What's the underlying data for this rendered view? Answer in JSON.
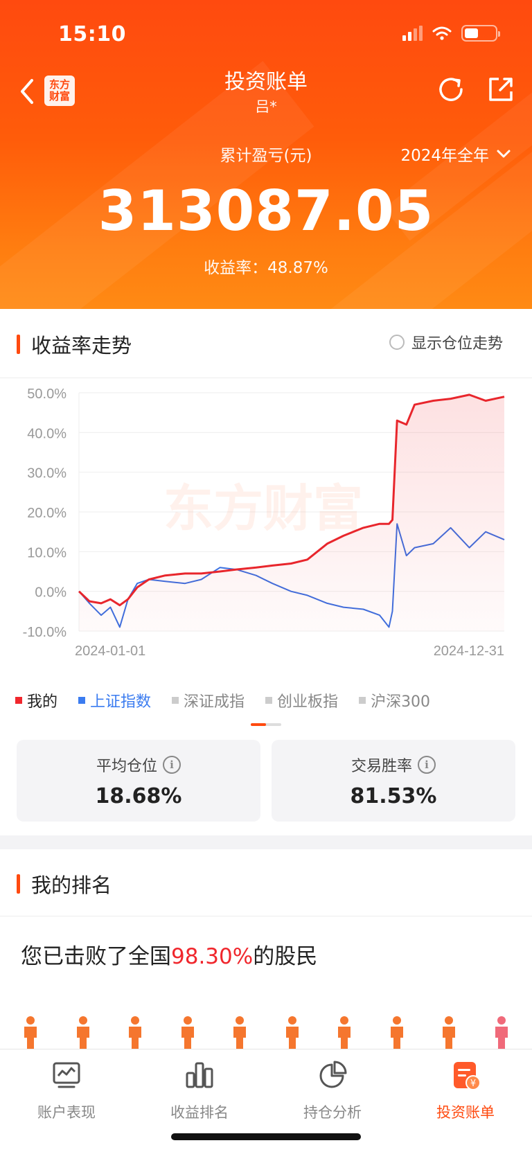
{
  "status": {
    "time": "15:10"
  },
  "header": {
    "logo_text": "东方\n财富",
    "title": "投资账单",
    "subtitle": "吕*",
    "pl_label": "累计盈亏(元)",
    "period": "2024年全年",
    "total_pl": "313087.05",
    "rate_line": "收益率：48.87%"
  },
  "trend": {
    "title": "收益率走势",
    "toggle_label": "显示仓位走势",
    "legend": [
      {
        "label": "我的",
        "color": "#f0272d",
        "text_color": "#222222"
      },
      {
        "label": "上证指数",
        "color": "#3b7cf0",
        "text_color": "#3b7cf0"
      },
      {
        "label": "深证成指",
        "color": "#cccccc",
        "text_color": "#888888"
      },
      {
        "label": "创业板指",
        "color": "#cccccc",
        "text_color": "#888888"
      },
      {
        "label": "沪深300",
        "color": "#cccccc",
        "text_color": "#888888"
      }
    ],
    "watermark": "东方财富"
  },
  "chart_data": {
    "type": "line",
    "x_start": "2024-01-01",
    "x_end": "2024-12-31",
    "yticks": [
      "50.0%",
      "40.0%",
      "30.0%",
      "20.0%",
      "10.0%",
      "0.0%",
      "-10.0%"
    ],
    "ylim": [
      -10,
      50
    ],
    "grid": true,
    "series": [
      {
        "name": "我的",
        "color": "#e8262c",
        "x": [
          "2024-01-01",
          "2024-01-10",
          "2024-01-20",
          "2024-01-28",
          "2024-02-05",
          "2024-02-12",
          "2024-02-20",
          "2024-03-01",
          "2024-03-15",
          "2024-04-01",
          "2024-04-15",
          "2024-05-01",
          "2024-05-15",
          "2024-06-01",
          "2024-06-15",
          "2024-07-01",
          "2024-07-15",
          "2024-08-01",
          "2024-08-15",
          "2024-09-01",
          "2024-09-15",
          "2024-09-23",
          "2024-09-26",
          "2024-09-30",
          "2024-10-08",
          "2024-10-15",
          "2024-10-31",
          "2024-11-15",
          "2024-12-01",
          "2024-12-15",
          "2024-12-31"
        ],
        "values": [
          0,
          -2.5,
          -3,
          -2,
          -3.5,
          -2,
          1,
          3,
          4,
          4.5,
          4.5,
          5,
          5.5,
          6,
          6.5,
          7,
          8,
          12,
          14,
          16,
          17,
          17,
          18,
          43,
          42,
          47,
          48,
          48.5,
          49.5,
          48,
          49
        ]
      },
      {
        "name": "上证指数",
        "color": "#3b6fe0",
        "x": [
          "2024-01-01",
          "2024-01-10",
          "2024-01-20",
          "2024-01-28",
          "2024-02-05",
          "2024-02-12",
          "2024-02-20",
          "2024-03-01",
          "2024-03-15",
          "2024-04-01",
          "2024-04-15",
          "2024-05-01",
          "2024-05-15",
          "2024-06-01",
          "2024-06-15",
          "2024-07-01",
          "2024-07-15",
          "2024-08-01",
          "2024-08-15",
          "2024-09-01",
          "2024-09-15",
          "2024-09-23",
          "2024-09-26",
          "2024-09-30",
          "2024-10-08",
          "2024-10-15",
          "2024-10-31",
          "2024-11-15",
          "2024-12-01",
          "2024-12-15",
          "2024-12-31"
        ],
        "values": [
          0,
          -3,
          -6,
          -4,
          -9,
          -2,
          2,
          3,
          2.5,
          2,
          3,
          6,
          5.5,
          4,
          2,
          0,
          -1,
          -3,
          -4,
          -4.5,
          -6,
          -9,
          -5,
          17,
          9,
          11,
          12,
          16,
          11,
          15,
          13
        ]
      }
    ]
  },
  "stats": {
    "avg_position_label": "平均仓位",
    "avg_position_value": "18.68%",
    "win_rate_label": "交易胜率",
    "win_rate_value": "81.53%"
  },
  "ranking": {
    "title": "我的排名",
    "text_pre": "您已击败了全国",
    "percent": "98.30%",
    "text_post": "的股民",
    "person_colors": [
      "#f5762e",
      "#f5762e",
      "#f5762e",
      "#f5762e",
      "#f5762e",
      "#f5762e",
      "#f5762e",
      "#f5762e",
      "#f5762e",
      "#f06a7a"
    ]
  },
  "tabs": [
    {
      "label": "账户表现",
      "icon": "monitor-chart-icon",
      "active": false
    },
    {
      "label": "收益排名",
      "icon": "bar-chart-icon",
      "active": false
    },
    {
      "label": "持仓分析",
      "icon": "pie-chart-icon",
      "active": false
    },
    {
      "label": "投资账单",
      "icon": "bill-icon",
      "active": true
    }
  ]
}
